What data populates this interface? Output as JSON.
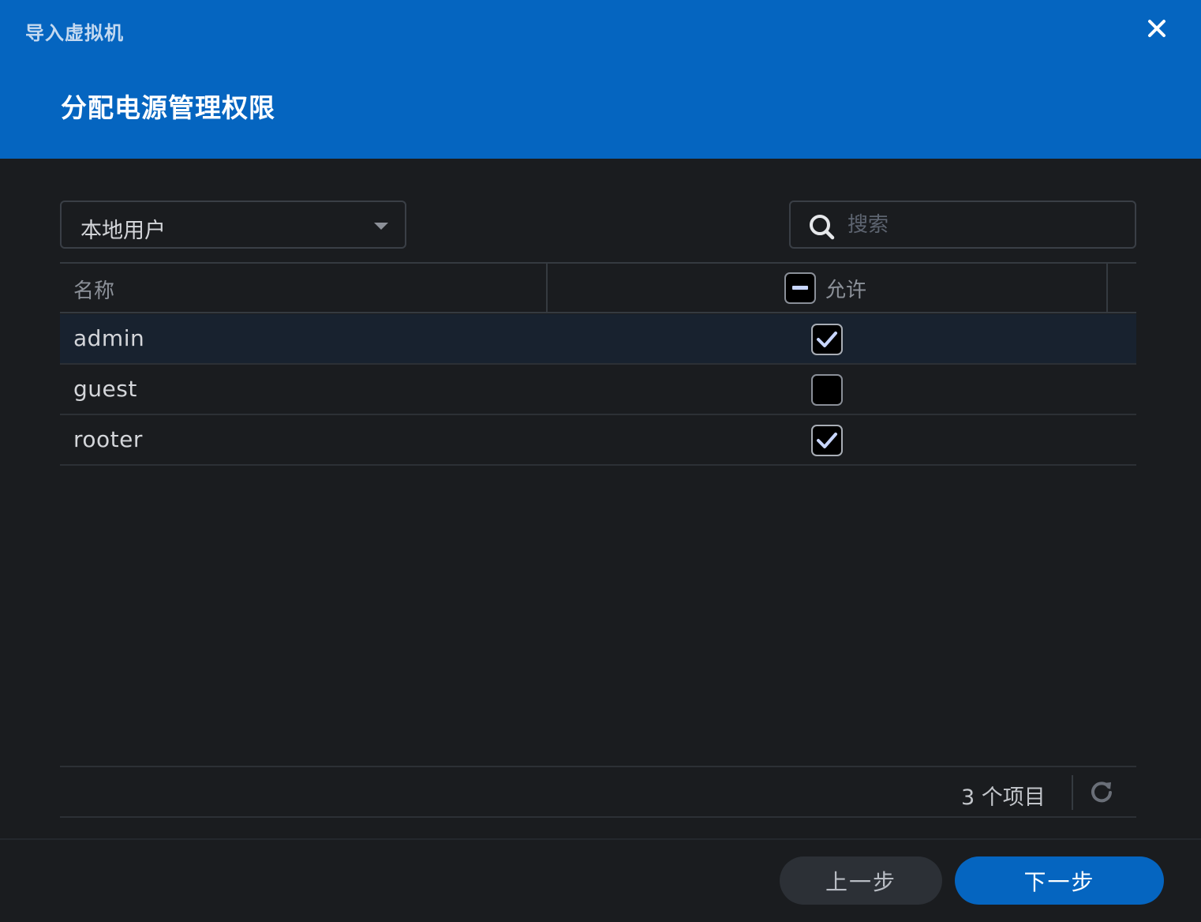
{
  "header": {
    "window_title": "导入虚拟机",
    "step_title": "分配电源管理权限"
  },
  "toolbar": {
    "user_type": "本地用户",
    "search_placeholder": "搜索"
  },
  "table": {
    "columns": [
      "名称",
      "允许"
    ],
    "header_checkbox_state": "indeterminate",
    "rows": [
      {
        "name": "admin",
        "allowed": true,
        "selected": true
      },
      {
        "name": "guest",
        "allowed": false,
        "selected": false
      },
      {
        "name": "rooter",
        "allowed": true,
        "selected": false
      }
    ]
  },
  "grid_footer": {
    "item_count": "3 个项目"
  },
  "buttons": {
    "back": "上一步",
    "next": "下一步"
  },
  "colors": {
    "accent": "#0565c0",
    "background": "#1a1c1f",
    "selected_row": "#18222f",
    "checkmark": "#c8d6ff"
  },
  "icons": {
    "close": "close-icon",
    "search": "search-icon",
    "dropdown": "caret-down-icon",
    "refresh": "refresh-icon",
    "check": "checkmark-icon",
    "indeterminate": "minus-icon"
  }
}
